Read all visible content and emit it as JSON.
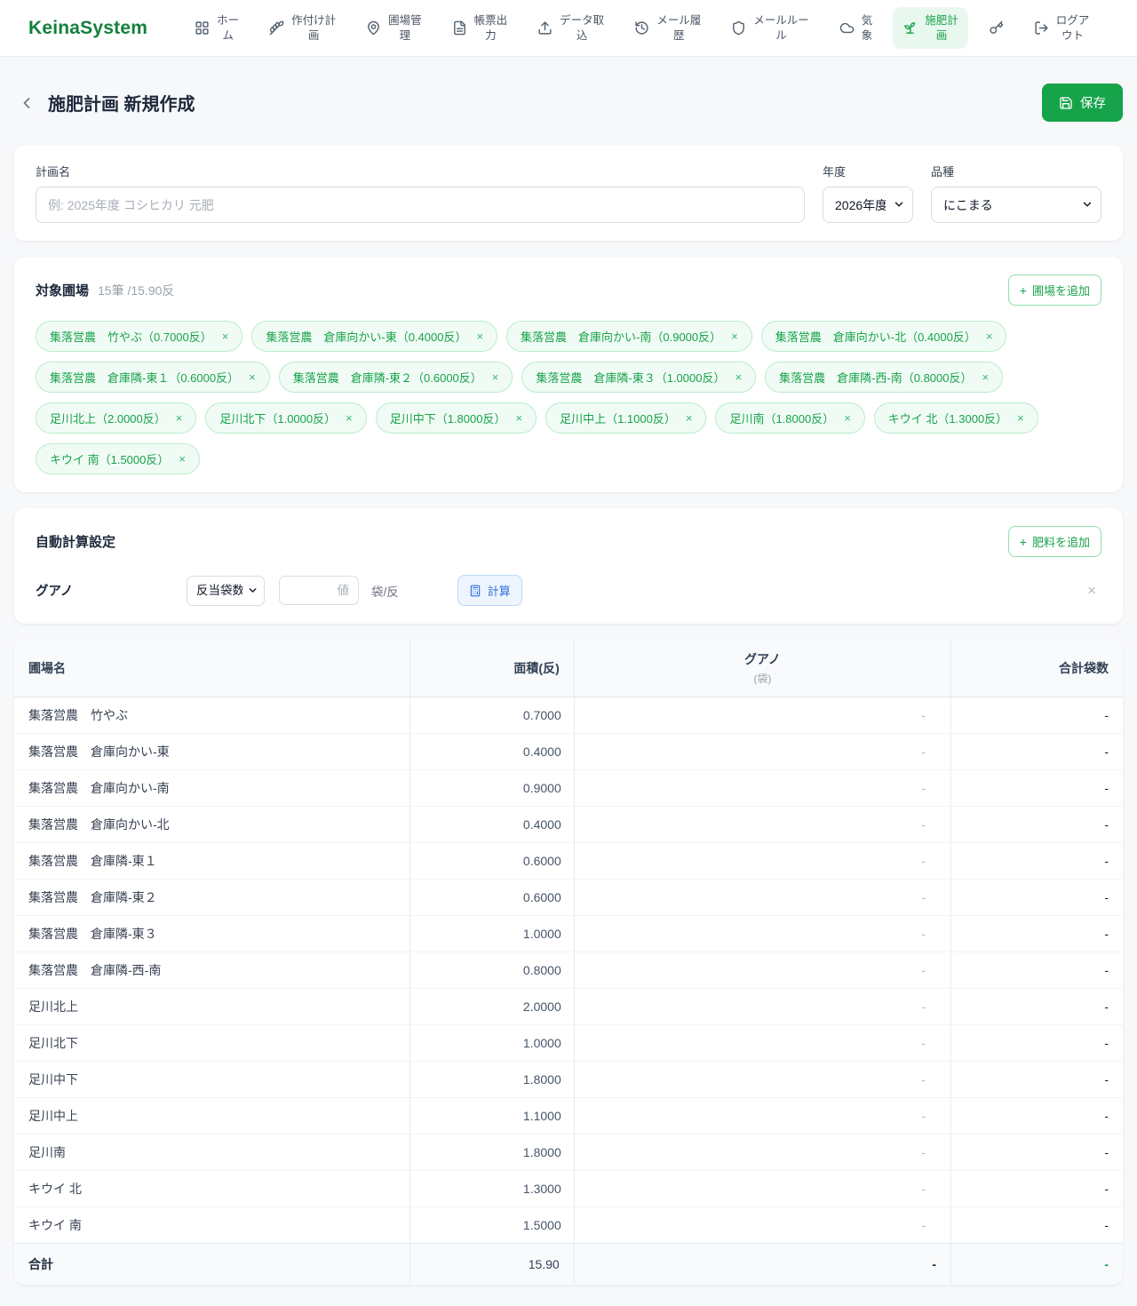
{
  "nav": {
    "brand": "KeinaSystem",
    "items": [
      {
        "icon": "grid-icon",
        "label": "ホー\nム"
      },
      {
        "icon": "wheat-icon",
        "label": "作付け計\n画"
      },
      {
        "icon": "map-pin-icon",
        "label": "圃場管\n理"
      },
      {
        "icon": "file-icon",
        "label": "帳票出\n力"
      },
      {
        "icon": "upload-icon",
        "label": "データ取\n込"
      },
      {
        "icon": "history-icon",
        "label": "メール履\n歴"
      },
      {
        "icon": "shield-icon",
        "label": "メールルー\nル"
      },
      {
        "icon": "cloud-icon",
        "label": "気\n象"
      },
      {
        "icon": "sprout-icon",
        "label": "施肥計\n画"
      },
      {
        "icon": "logout-icon",
        "label": "ログア\nウト"
      }
    ]
  },
  "header": {
    "title": "施肥計画 新規作成",
    "save_label": "保存"
  },
  "plan_form": {
    "name_label": "計画名",
    "name_placeholder": "例: 2025年度 コシヒカリ 元肥",
    "year_label": "年度",
    "year_value": "2026年度",
    "variety_label": "品種",
    "variety_value": "にこまる"
  },
  "fields_section": {
    "title": "対象圃場",
    "summary": "15筆 /15.90反",
    "add_button": "圃場を追加",
    "plus_icon": "+",
    "remove_icon": "×",
    "chips": [
      "集落営農　竹やぶ（0.7000反）",
      "集落営農　倉庫向かい-東（0.4000反）",
      "集落営農　倉庫向かい-南（0.9000反）",
      "集落営農　倉庫向かい-北（0.4000反）",
      "集落営農　倉庫隣-東１（0.6000反）",
      "集落営農　倉庫隣-東２（0.6000反）",
      "集落営農　倉庫隣-東３（1.0000反）",
      "集落営農　倉庫隣-西-南（0.8000反）",
      "足川北上（2.0000反）",
      "足川北下（1.0000反）",
      "足川中下（1.8000反）",
      "足川中上（1.1000反）",
      "足川南（1.8000反）",
      "キウイ 北（1.3000反）",
      "キウイ 南（1.5000反）"
    ]
  },
  "calc_section": {
    "title": "自動計算設定",
    "add_button": "肥料を追加",
    "fertilizer_name": "グアノ",
    "mode_value": "反当袋数",
    "value_placeholder": "値",
    "unit": "袋/反",
    "calc_button": "計算",
    "close_icon": "×"
  },
  "table": {
    "headers": {
      "field": "圃場名",
      "area": "面積(反)",
      "guano": "グアノ",
      "guano_sub": "(袋)",
      "total": "合計袋数"
    },
    "rows": [
      {
        "name": "集落営農　竹やぶ",
        "area": "0.7000",
        "guano": "-",
        "total": "-"
      },
      {
        "name": "集落営農　倉庫向かい-東",
        "area": "0.4000",
        "guano": "-",
        "total": "-"
      },
      {
        "name": "集落営農　倉庫向かい-南",
        "area": "0.9000",
        "guano": "-",
        "total": "-"
      },
      {
        "name": "集落営農　倉庫向かい-北",
        "area": "0.4000",
        "guano": "-",
        "total": "-"
      },
      {
        "name": "集落営農　倉庫隣-東１",
        "area": "0.6000",
        "guano": "-",
        "total": "-"
      },
      {
        "name": "集落営農　倉庫隣-東２",
        "area": "0.6000",
        "guano": "-",
        "total": "-"
      },
      {
        "name": "集落営農　倉庫隣-東３",
        "area": "1.0000",
        "guano": "-",
        "total": "-"
      },
      {
        "name": "集落営農　倉庫隣-西-南",
        "area": "0.8000",
        "guano": "-",
        "total": "-"
      },
      {
        "name": "足川北上",
        "area": "2.0000",
        "guano": "-",
        "total": "-"
      },
      {
        "name": "足川北下",
        "area": "1.0000",
        "guano": "-",
        "total": "-"
      },
      {
        "name": "足川中下",
        "area": "1.8000",
        "guano": "-",
        "total": "-"
      },
      {
        "name": "足川中上",
        "area": "1.1000",
        "guano": "-",
        "total": "-"
      },
      {
        "name": "足川南",
        "area": "1.8000",
        "guano": "-",
        "total": "-"
      },
      {
        "name": "キウイ 北",
        "area": "1.3000",
        "guano": "-",
        "total": "-"
      },
      {
        "name": "キウイ 南",
        "area": "1.5000",
        "guano": "-",
        "total": "-"
      }
    ],
    "total_row": {
      "name": "合計",
      "area": "15.90",
      "guano": "-",
      "total": "-"
    }
  },
  "colors": {
    "accent_green": "#16a34a",
    "accent_blue": "#2e6fe0",
    "active_nav_bg": "#e9f8ef"
  }
}
